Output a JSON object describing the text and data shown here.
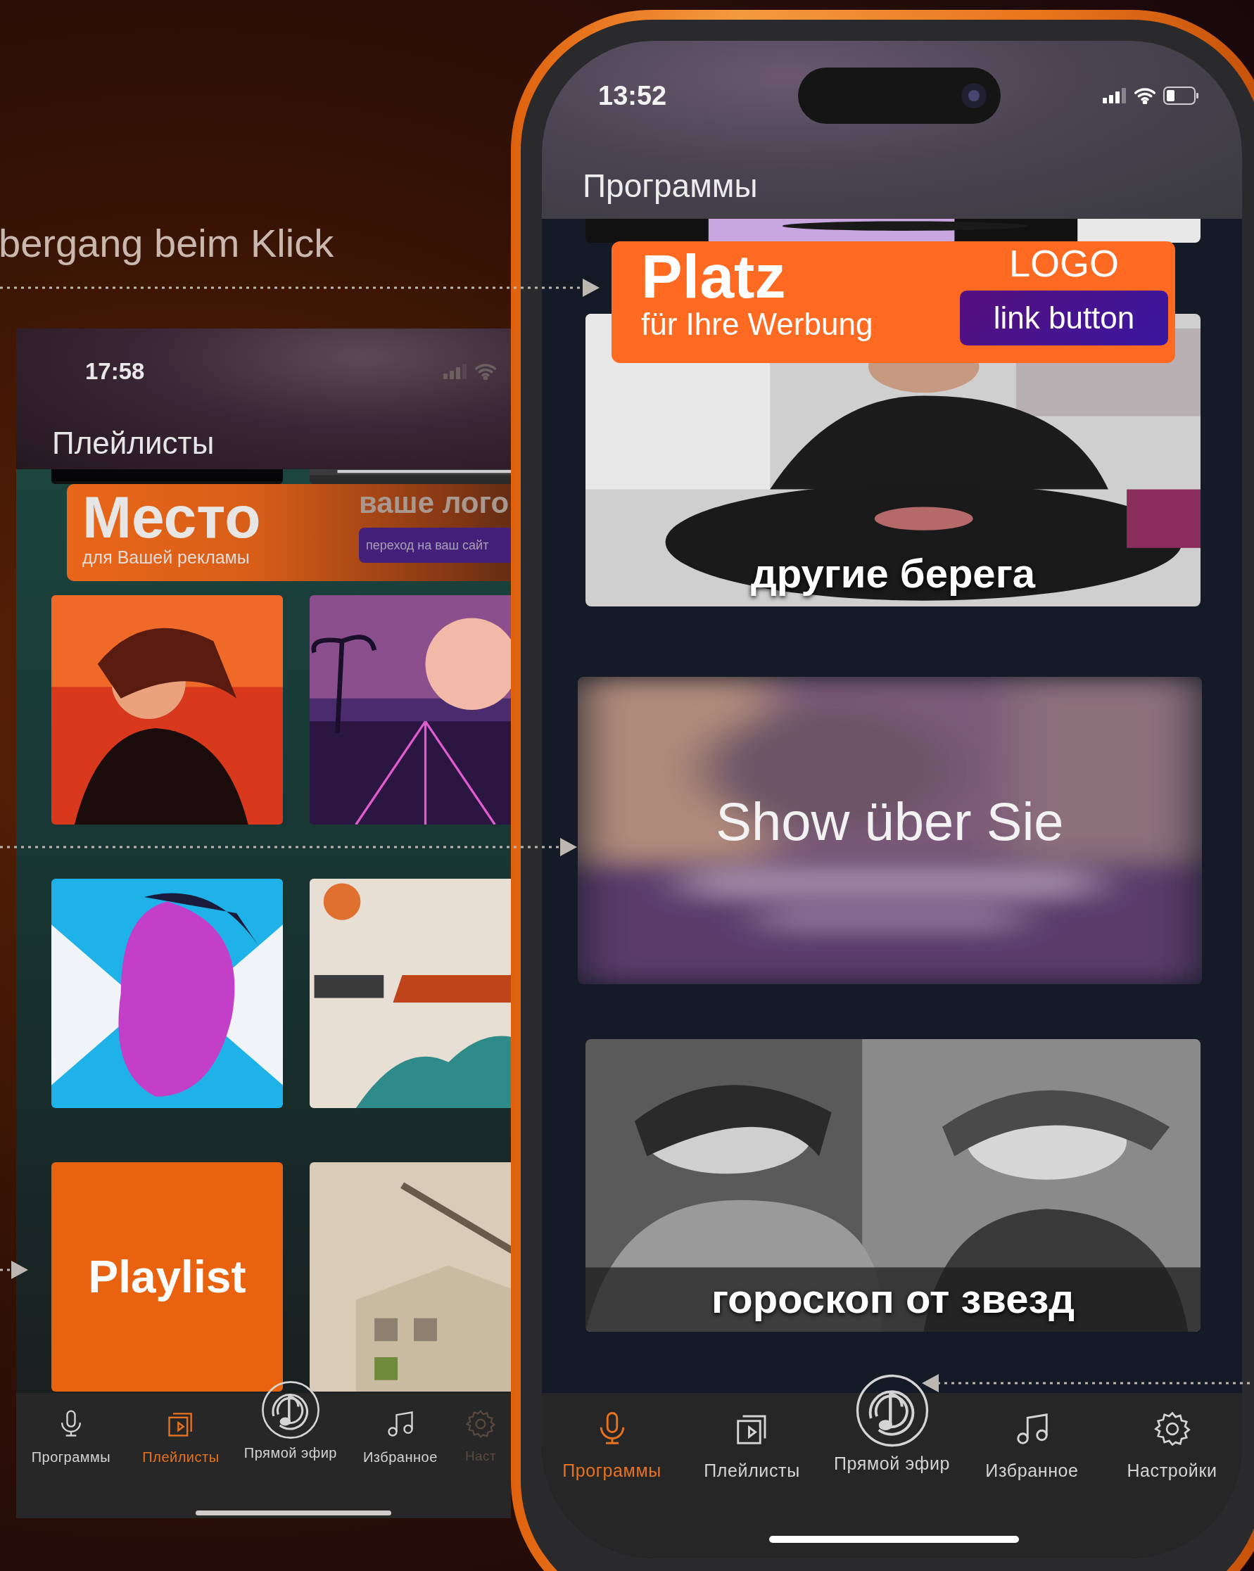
{
  "caption": "bergang beim Klick",
  "playlists_screen": {
    "status_time": "17:58",
    "title": "Плейлисты",
    "ad": {
      "headline": "Место",
      "subline": "для Вашей рекламы",
      "logo_text": "ваше лого",
      "link_button": "переход на ваш сайт"
    },
    "tiles": [
      {
        "kind": "picture"
      },
      {
        "kind": "picture"
      },
      {
        "kind": "picture"
      },
      {
        "kind": "picture"
      },
      {
        "kind": "picture"
      },
      {
        "kind": "picture"
      },
      {
        "kind": "label",
        "label": "Playlist"
      },
      {
        "kind": "picture"
      }
    ],
    "tab_bar": [
      {
        "label": "Программы",
        "selected": false
      },
      {
        "label": "Плейлисты",
        "selected": true
      },
      {
        "label": "Прямой эфир",
        "selected": false
      },
      {
        "label": "Избранное",
        "selected": false
      },
      {
        "label": "Наст",
        "selected": false
      }
    ]
  },
  "programs_screen": {
    "status_time": "13:52",
    "title": "Программы",
    "ad": {
      "headline": "Platz",
      "subline": "für Ihre Werbung",
      "logo_text": "LOGO",
      "link_button": "link button"
    },
    "cards": [
      {
        "title": "другие берега",
        "blurred": false
      },
      {
        "title": "Show über Sie",
        "blurred": true
      },
      {
        "title": "гороскоп от звезд",
        "blurred": false
      }
    ],
    "tab_bar": [
      {
        "label": "Программы",
        "selected": true
      },
      {
        "label": "Плейлисты",
        "selected": false
      },
      {
        "label": "Прямой эфир",
        "selected": false
      },
      {
        "label": "Избранное",
        "selected": false
      },
      {
        "label": "Настройки",
        "selected": false
      }
    ]
  }
}
